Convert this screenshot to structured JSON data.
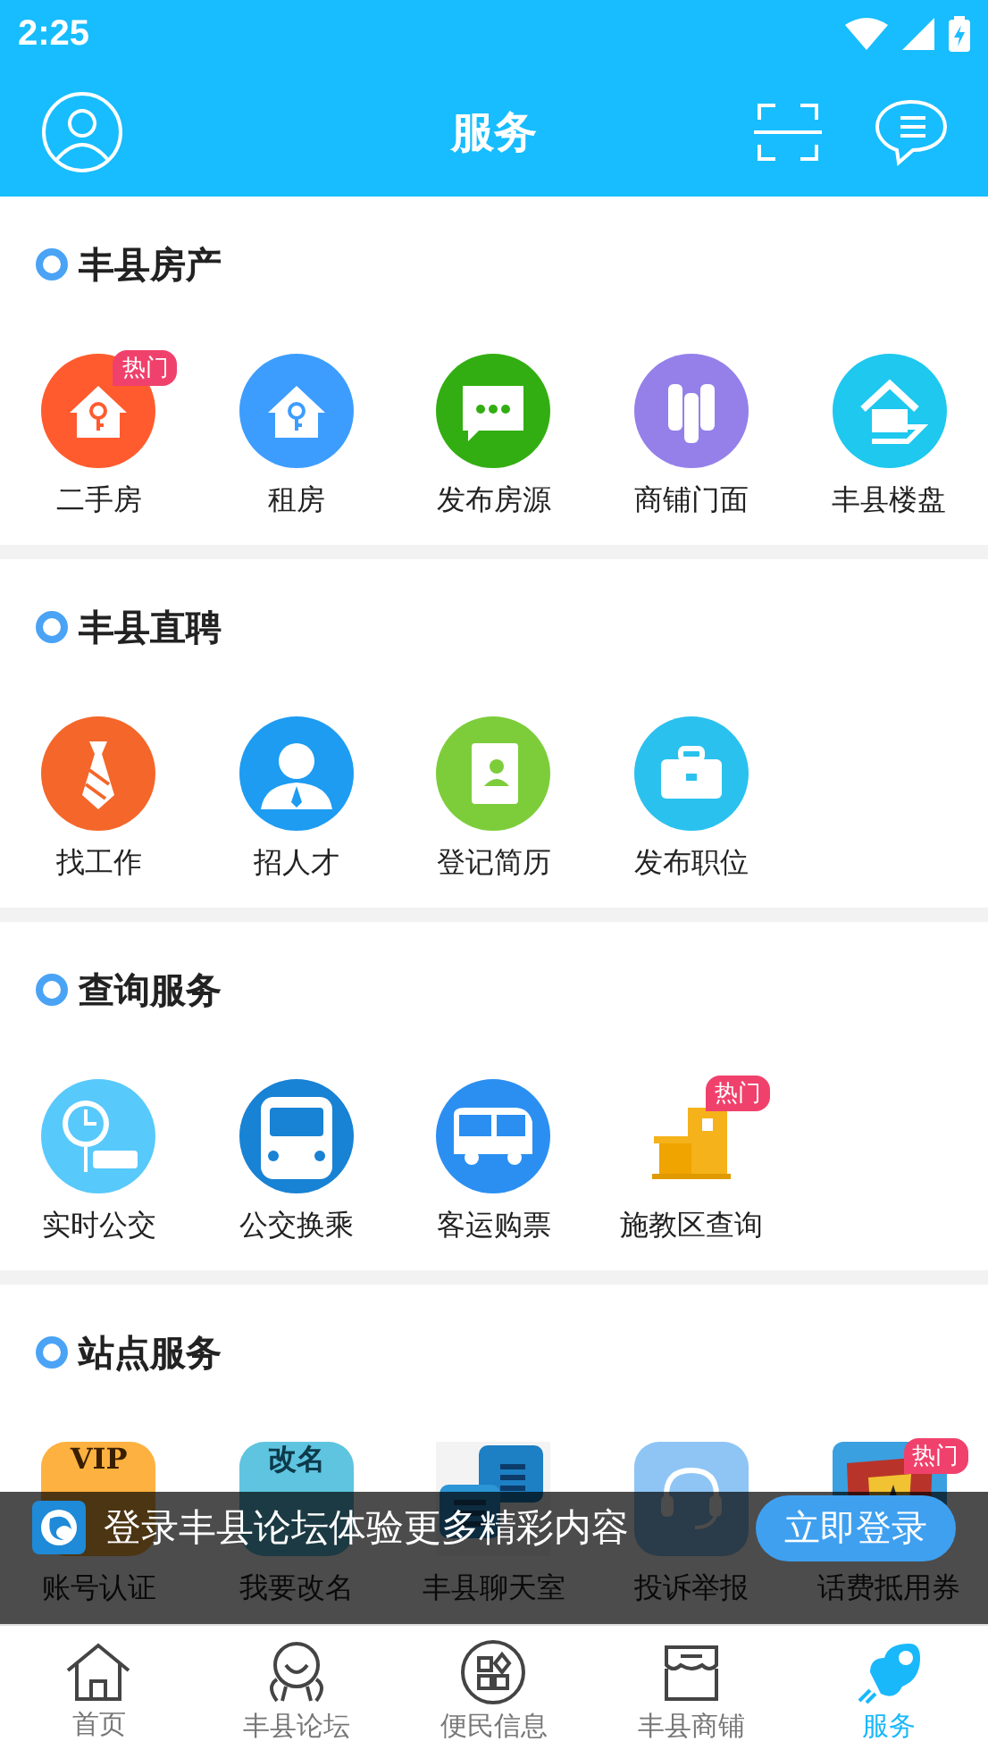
{
  "status_bar": {
    "time": "2:25"
  },
  "header": {
    "title": "服务"
  },
  "sections": [
    {
      "title": "丰县房产",
      "items": [
        {
          "label": "二手房",
          "badge": "热门"
        },
        {
          "label": "租房"
        },
        {
          "label": "发布房源"
        },
        {
          "label": "商铺门面"
        },
        {
          "label": "丰县楼盘"
        }
      ]
    },
    {
      "title": "丰县直聘",
      "items": [
        {
          "label": "找工作"
        },
        {
          "label": "招人才"
        },
        {
          "label": "登记简历"
        },
        {
          "label": "发布职位"
        }
      ]
    },
    {
      "title": "查询服务",
      "items": [
        {
          "label": "实时公交"
        },
        {
          "label": "公交换乘"
        },
        {
          "label": "客运购票"
        },
        {
          "label": "施教区查询",
          "badge": "热门"
        }
      ]
    },
    {
      "title": "站点服务",
      "items": [
        {
          "label": "账号认证",
          "icon_text": "VIP"
        },
        {
          "label": "我要改名",
          "icon_text": "改名"
        },
        {
          "label": "丰县聊天室"
        },
        {
          "label": "投诉举报"
        },
        {
          "label": "话费抵用券",
          "badge": "热门"
        }
      ]
    }
  ],
  "login_banner": {
    "text": "登录丰县论坛体验更多精彩内容",
    "button": "立即登录"
  },
  "bottom_nav": [
    {
      "label": "首页",
      "selected": false
    },
    {
      "label": "丰县论坛",
      "selected": false
    },
    {
      "label": "便民信息",
      "selected": false
    },
    {
      "label": "丰县商铺",
      "selected": false
    },
    {
      "label": "服务",
      "selected": true
    }
  ]
}
